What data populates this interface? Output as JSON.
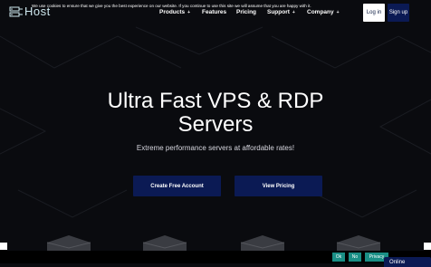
{
  "brand": {
    "name": "Host"
  },
  "nav": {
    "items": [
      {
        "label": "Products",
        "caret": "+"
      },
      {
        "label": "Features",
        "caret": ""
      },
      {
        "label": "Pricing",
        "caret": ""
      },
      {
        "label": "Support",
        "caret": "+"
      },
      {
        "label": "Company",
        "caret": "+"
      }
    ],
    "login_label": "Log in",
    "signup_label": "Sign up"
  },
  "hero": {
    "title_line1": "Ultra Fast VPS & RDP",
    "title_line2": "Servers",
    "subtitle": "Extreme performance servers at affordable rates!",
    "cta_primary": "Create Free Account",
    "cta_secondary": "View Pricing"
  },
  "cookie": {
    "text": "We use cookies to ensure that we give you the best experience on our website. If you continue to use this site we will assume that you are happy with it.",
    "ok_label": "Ok",
    "no_label": "No",
    "privacy_label": "Privacy"
  },
  "chat": {
    "label": "Online"
  },
  "colors": {
    "accent": "#0b1a54",
    "cookie_button": "#1a8f86",
    "background": "#0a0b0f"
  }
}
